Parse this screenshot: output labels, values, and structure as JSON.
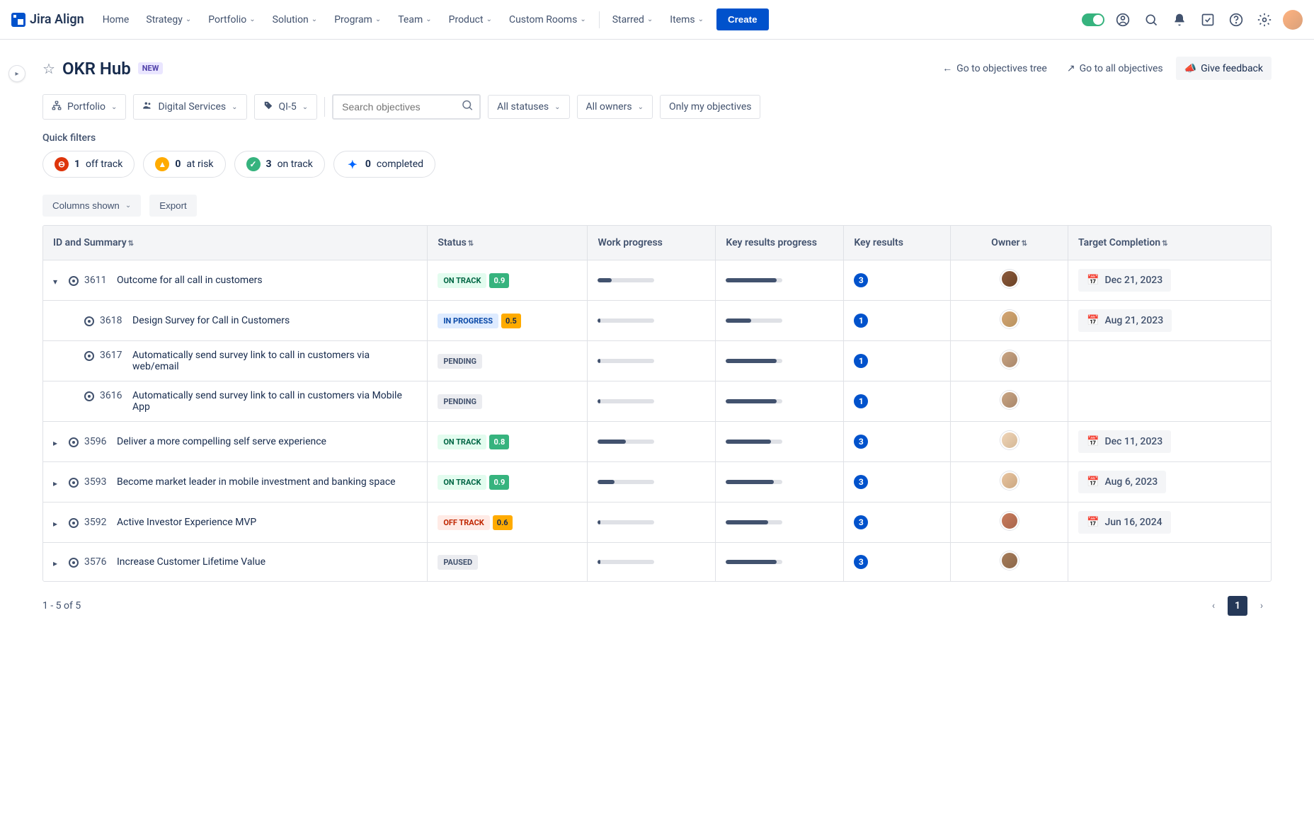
{
  "brand": "Jira Align",
  "nav": {
    "items": [
      "Home",
      "Strategy",
      "Portfolio",
      "Solution",
      "Program",
      "Team",
      "Product",
      "Custom Rooms"
    ],
    "secondary": [
      "Starred",
      "Items"
    ],
    "create": "Create"
  },
  "page": {
    "title": "OKR Hub",
    "badge": "NEW",
    "go_tree": "Go to objectives tree",
    "go_all": "Go to all objectives",
    "feedback": "Give feedback"
  },
  "filters": {
    "portfolio": "Portfolio",
    "digital": "Digital Services",
    "qi": "QI-5",
    "search_placeholder": "Search objectives",
    "statuses": "All statuses",
    "owners": "All owners",
    "only_mine": "Only my objectives"
  },
  "quick_filters": {
    "label": "Quick filters",
    "items": [
      {
        "count": "1",
        "text": "off track",
        "color": "red",
        "glyph": "⊖"
      },
      {
        "count": "0",
        "text": "at risk",
        "color": "yellow",
        "glyph": "▲"
      },
      {
        "count": "3",
        "text": "on track",
        "color": "green",
        "glyph": "✓"
      },
      {
        "count": "0",
        "text": "completed",
        "color": "blue",
        "glyph": "✦"
      }
    ]
  },
  "toolbar": {
    "columns": "Columns shown",
    "export": "Export"
  },
  "table": {
    "headers": {
      "id": "ID and Summary",
      "status": "Status",
      "work": "Work progress",
      "krp": "Key results progress",
      "kr": "Key results",
      "owner": "Owner",
      "target": "Target Completion"
    },
    "rows": [
      {
        "expand": "▾",
        "indent": 0,
        "id": "3611",
        "summary": "Outcome for all call in customers",
        "status": "ON TRACK",
        "status_class": "st-ontrack",
        "score": "0.9",
        "wp": 25,
        "krp": 90,
        "kr": "3",
        "avatar": "av-1",
        "date": "Dec 21, 2023"
      },
      {
        "expand": "",
        "indent": 1,
        "id": "3618",
        "summary": "Design Survey for Call in Customers",
        "status": "IN PROGRESS",
        "status_class": "st-inprogress",
        "score": "0.5",
        "wp": 4,
        "krp": 45,
        "kr": "1",
        "avatar": "av-2",
        "date": "Aug 21, 2023"
      },
      {
        "expand": "",
        "indent": 1,
        "id": "3617",
        "summary": "Automatically send survey link to call in customers via web/email",
        "status": "PENDING",
        "status_class": "st-pending",
        "score": "",
        "wp": 4,
        "krp": 90,
        "kr": "1",
        "avatar": "av-3",
        "date": ""
      },
      {
        "expand": "",
        "indent": 1,
        "id": "3616",
        "summary": "Automatically send survey link to call in customers via Mobile App",
        "status": "PENDING",
        "status_class": "st-pending",
        "score": "",
        "wp": 4,
        "krp": 90,
        "kr": "1",
        "avatar": "av-3",
        "date": ""
      },
      {
        "expand": "▸",
        "indent": 0,
        "id": "3596",
        "summary": "Deliver a more compelling self serve experience",
        "status": "ON TRACK",
        "status_class": "st-ontrack",
        "score": "0.8",
        "wp": 50,
        "krp": 80,
        "kr": "3",
        "avatar": "av-4",
        "date": "Dec 11, 2023"
      },
      {
        "expand": "▸",
        "indent": 0,
        "id": "3593",
        "summary": "Become market leader in mobile investment and banking space",
        "status": "ON TRACK",
        "status_class": "st-ontrack",
        "score": "0.9",
        "wp": 30,
        "krp": 85,
        "kr": "3",
        "avatar": "av-5",
        "date": "Aug 6, 2023"
      },
      {
        "expand": "▸",
        "indent": 0,
        "id": "3592",
        "summary": "Active Investor Experience MVP",
        "status": "OFF TRACK",
        "status_class": "st-offtrack",
        "score": "0.6",
        "wp": 4,
        "krp": 75,
        "kr": "3",
        "avatar": "av-7",
        "date": "Jun 16, 2024"
      },
      {
        "expand": "▸",
        "indent": 0,
        "id": "3576",
        "summary": "Increase Customer Lifetime Value",
        "status": "PAUSED",
        "status_class": "st-paused",
        "score": "",
        "wp": 4,
        "krp": 90,
        "kr": "3",
        "avatar": "av-6",
        "date": ""
      }
    ]
  },
  "pager": {
    "info": "1 - 5 of 5",
    "current": "1"
  }
}
